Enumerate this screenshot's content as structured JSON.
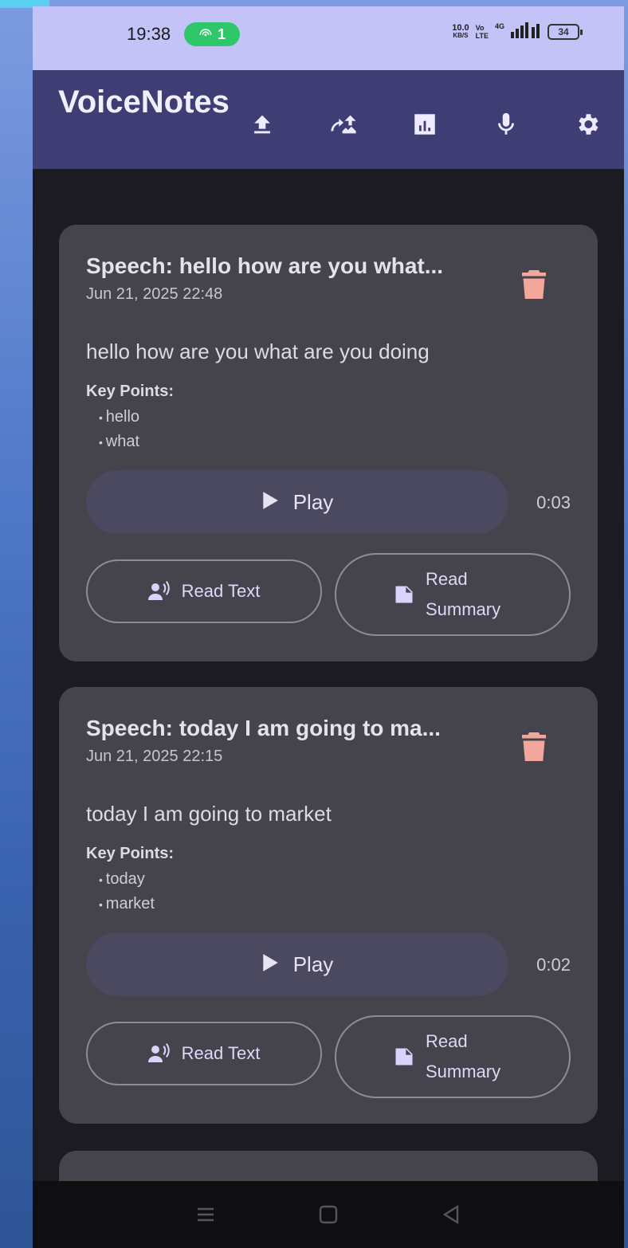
{
  "status_bar": {
    "time": "19:38",
    "hotspot_count": "1",
    "net_speed": "10.0",
    "net_unit": "KB/S",
    "volte_top": "Vo",
    "volte_bottom": "LTE",
    "network": "4G",
    "battery": "34"
  },
  "app_bar": {
    "title": "VoiceNotes",
    "actions": [
      {
        "name": "upload",
        "icon": "upload-icon"
      },
      {
        "name": "sync",
        "icon": "sync-icon"
      },
      {
        "name": "analytics",
        "icon": "chart-icon"
      },
      {
        "name": "record",
        "icon": "mic-icon"
      },
      {
        "name": "settings",
        "icon": "gear-icon"
      }
    ]
  },
  "notes": [
    {
      "title": "Speech: hello how are you what...",
      "date": "Jun 21, 2025 22:48",
      "text": "hello how are you what are you doing",
      "key_points_heading": "Key Points:",
      "key_points": [
        "hello",
        "what"
      ],
      "play_label": "Play",
      "duration": "0:03",
      "read_text_label": "Read Text",
      "read_summary_label": "Read Summary"
    },
    {
      "title": "Speech: today I am going to ma...",
      "date": "Jun 21, 2025 22:15",
      "text": "today I am going to market",
      "key_points_heading": "Key Points:",
      "key_points": [
        "today",
        "market"
      ],
      "play_label": "Play",
      "duration": "0:02",
      "read_text_label": "Read Text",
      "read_summary_label": "Read Summary"
    }
  ],
  "colors": {
    "status_bar_bg": "#c4c3f7",
    "app_bar_bg": "#3e3e74",
    "card_bg": "#45444d",
    "delete_icon": "#f3a69c",
    "hotspot_green": "#2fc76a"
  }
}
